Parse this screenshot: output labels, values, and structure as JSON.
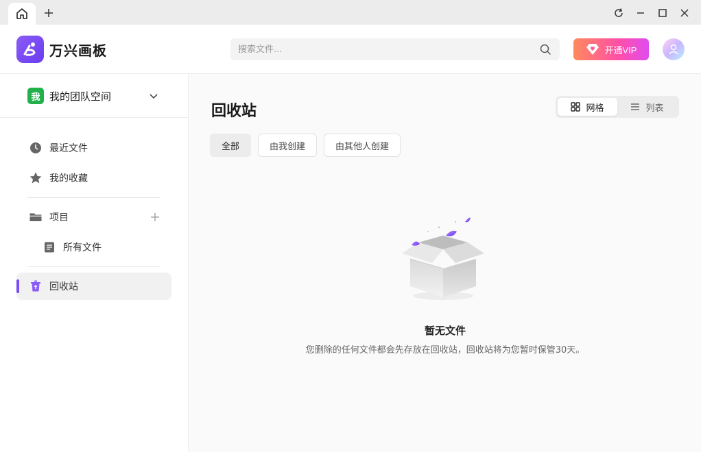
{
  "app": {
    "brand": "万兴画板",
    "brand_color": "#7b4df5"
  },
  "tabbar": {
    "home_icon": "home-icon",
    "new_tab_icon": "plus-icon",
    "controls": [
      "refresh-icon",
      "minimize-icon",
      "maximize-icon",
      "close-icon"
    ]
  },
  "header": {
    "search_placeholder": "搜索文件...",
    "vip_label": "开通VIP"
  },
  "sidebar": {
    "team": {
      "badge": "我",
      "name": "我的团队空间"
    },
    "items": [
      {
        "label": "最近文件",
        "icon": "clock-icon"
      },
      {
        "label": "我的收藏",
        "icon": "star-icon"
      },
      {
        "label": "项目",
        "icon": "folder-icon"
      },
      {
        "label": "所有文件",
        "icon": "file-list-icon"
      },
      {
        "label": "回收站",
        "icon": "trash-icon",
        "active": true
      }
    ]
  },
  "main": {
    "title": "回收站",
    "views": [
      {
        "label": "网格",
        "icon": "grid-icon",
        "selected": true
      },
      {
        "label": "列表",
        "icon": "list-icon",
        "selected": false
      }
    ],
    "filters": [
      {
        "label": "全部",
        "selected": true
      },
      {
        "label": "由我创建",
        "selected": false
      },
      {
        "label": "由其他人创建",
        "selected": false
      }
    ],
    "empty": {
      "title": "暂无文件",
      "description": "您删除的任何文件都会先存放在回收站，回收站将为您暂时保管30天。"
    }
  }
}
